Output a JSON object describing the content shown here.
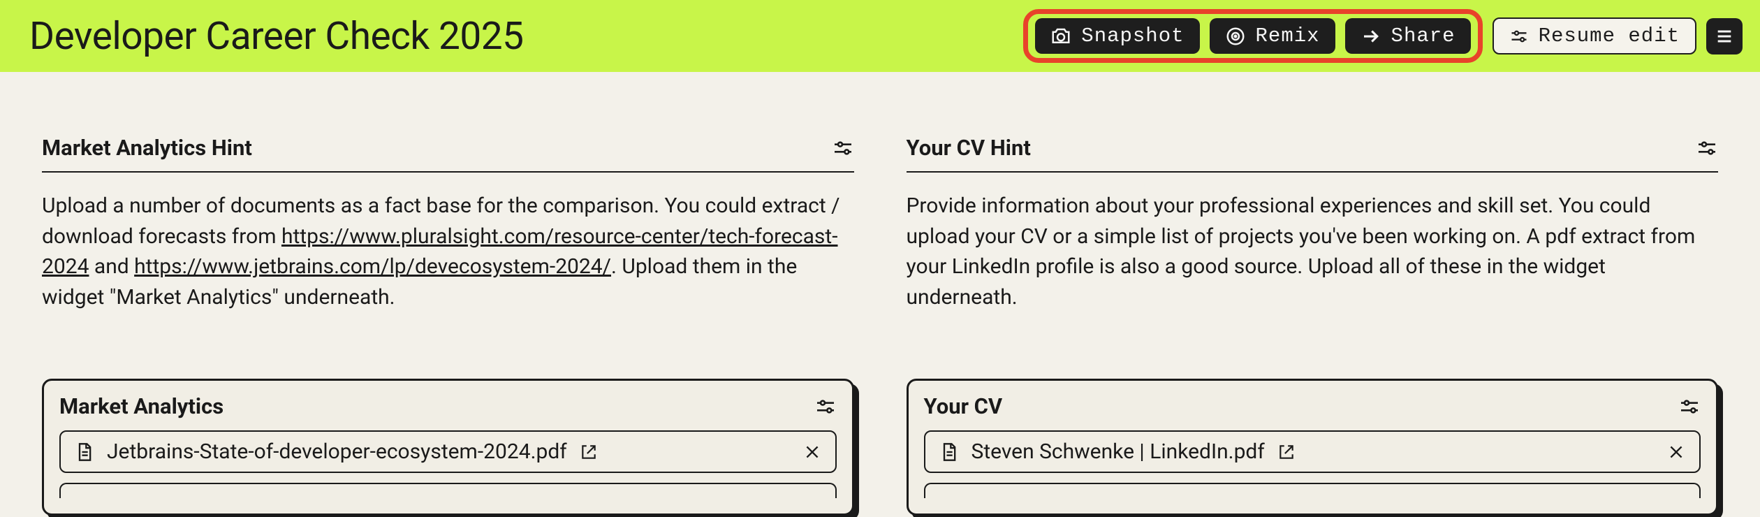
{
  "header": {
    "title": "Developer Career Check 2025",
    "actions": {
      "snapshot": "Snapshot",
      "remix": "Remix",
      "share": "Share",
      "resume_edit": "Resume edit"
    }
  },
  "left": {
    "hint_title": "Market Analytics Hint",
    "hint_text_pre": "Upload a number of documents as a fact base for the comparison. You could extract / download forecasts from ",
    "hint_link1": "https://www.pluralsight.com/resource-center/tech-forecast-2024",
    "hint_text_mid": " and ",
    "hint_link2": "https://www.jetbrains.com/lp/devecosystem-2024/",
    "hint_text_post": ". Upload them in the widget \"Market Analytics\" underneath.",
    "widget_title": "Market Analytics",
    "file1": "Jetbrains-State-of-developer-ecosystem-2024.pdf"
  },
  "right": {
    "hint_title": "Your CV Hint",
    "hint_text": "Provide information about your professional experiences and skill set. You could upload your CV or a simple list of projects you've been working on. A pdf extract from your LinkedIn profile is also a good source. Upload all of these in the widget underneath.",
    "widget_title": "Your CV",
    "file1": "Steven Schwenke | LinkedIn.pdf"
  }
}
